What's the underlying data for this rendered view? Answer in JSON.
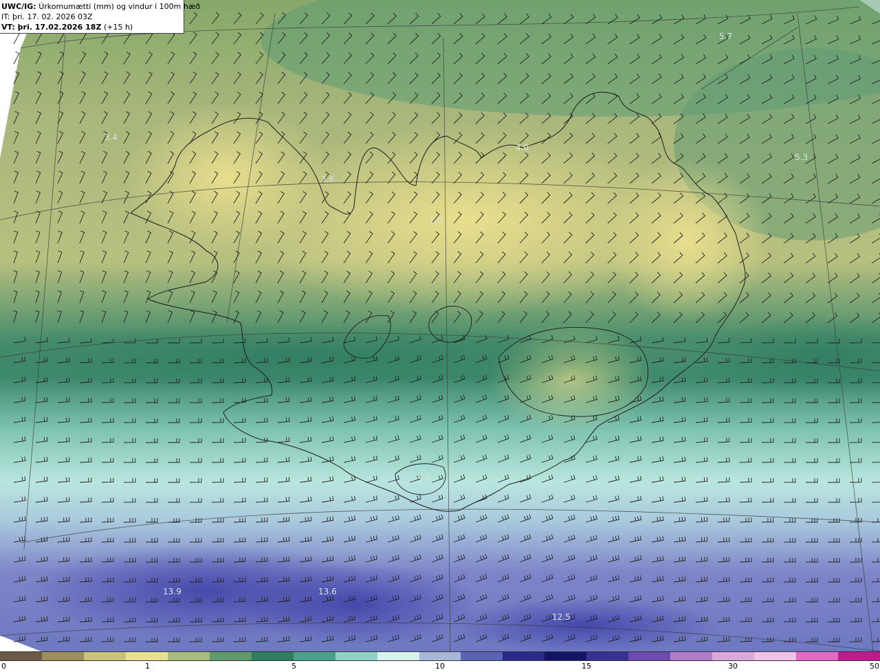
{
  "header": {
    "model": "UWC/IG:",
    "field": "Úrkomumætti (mm) og vindur í 100m hæð",
    "init_time": "IT: þri. 17. 02. 2026 03Z",
    "valid_prefix": "VT: þri. 17.02.2026 18Z",
    "valid_suffix": "(+15 h)"
  },
  "value_labels": [
    {
      "text": "5.7"
    },
    {
      "text": "3.4"
    },
    {
      "text": "4.0"
    },
    {
      "text": "5.3"
    },
    {
      "text": "3.6"
    },
    {
      "text": "1.0"
    },
    {
      "text": "4.4"
    },
    {
      "text": "13.9"
    },
    {
      "text": "13.6"
    },
    {
      "text": "12.5"
    }
  ],
  "colorbar": {
    "ticks": [
      "0",
      "1",
      "5",
      "10",
      "15",
      "30",
      "50"
    ],
    "colors": [
      "#6b5a46",
      "#9c8f5a",
      "#c9c27a",
      "#e6e08f",
      "#a7bd7c",
      "#5e9a6c",
      "#2f7e5f",
      "#4aa08b",
      "#8fd1c6",
      "#d8f4ef",
      "#a8b6d8",
      "#5b62b8",
      "#2a2a8c",
      "#13136b",
      "#3a2f94",
      "#6e4bb0",
      "#b27ccc",
      "#dca8d8",
      "#f2c2e6",
      "#e46bc4",
      "#c4188f"
    ]
  }
}
